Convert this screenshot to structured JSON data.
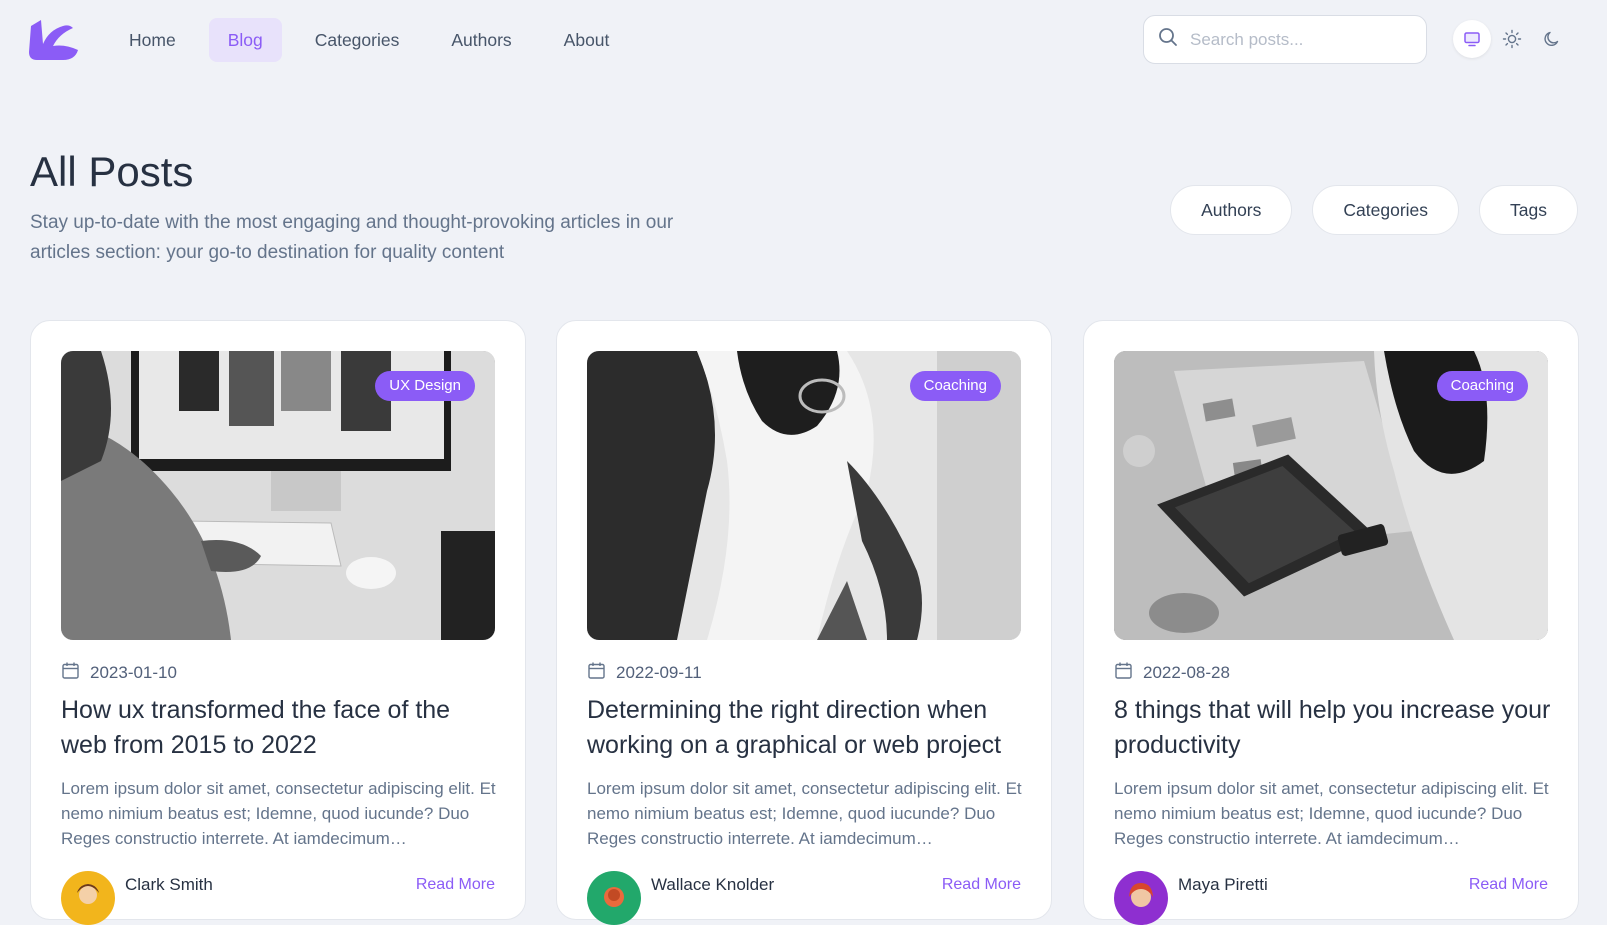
{
  "nav": {
    "links": [
      "Home",
      "Blog",
      "Categories",
      "Authors",
      "About"
    ],
    "active_index": 1
  },
  "search": {
    "placeholder": "Search posts..."
  },
  "theme_icons": [
    "monitor-icon",
    "sun-icon",
    "moon-icon"
  ],
  "header": {
    "title": "All Posts",
    "subtitle": "Stay up-to-date with the most engaging and thought-provoking articles in our articles section: your go-to destination for quality content"
  },
  "filters": [
    "Authors",
    "Categories",
    "Tags"
  ],
  "posts": [
    {
      "category": "UX Design",
      "date": "2023-01-10",
      "title": "How ux transformed the face of the web from 2015 to 2022",
      "excerpt": "Lorem ipsum dolor sit amet, consectetur adipiscing elit. Et nemo nimium beatus est; Idemne, quod iucunde? Duo Reges constructio interrete. At iamdecimum…",
      "author": "Clark Smith",
      "read_more": "Read More"
    },
    {
      "category": "Coaching",
      "date": "2022-09-11",
      "title": "Determining the right direction when working on a graphical or web project",
      "excerpt": "Lorem ipsum dolor sit amet, consectetur adipiscing elit. Et nemo nimium beatus est; Idemne, quod iucunde? Duo Reges constructio interrete. At iamdecimum…",
      "author": "Wallace Knolder",
      "read_more": "Read More"
    },
    {
      "category": "Coaching",
      "date": "2022-08-28",
      "title": "8 things that will help you increase your productivity",
      "excerpt": "Lorem ipsum dolor sit amet, consectetur adipiscing elit. Et nemo nimium beatus est; Idemne, quod iucunde? Duo Reges constructio interrete. At iamdecimum…",
      "author": "Maya Piretti",
      "read_more": "Read More"
    }
  ],
  "colors": {
    "accent": "#8b5cf6",
    "accent_soft": "#e8e2fb",
    "background": "#f0f2f7",
    "avatar_1": "#f2b51c",
    "avatar_2": "#22a86b",
    "avatar_3": "#8e2fd0"
  }
}
